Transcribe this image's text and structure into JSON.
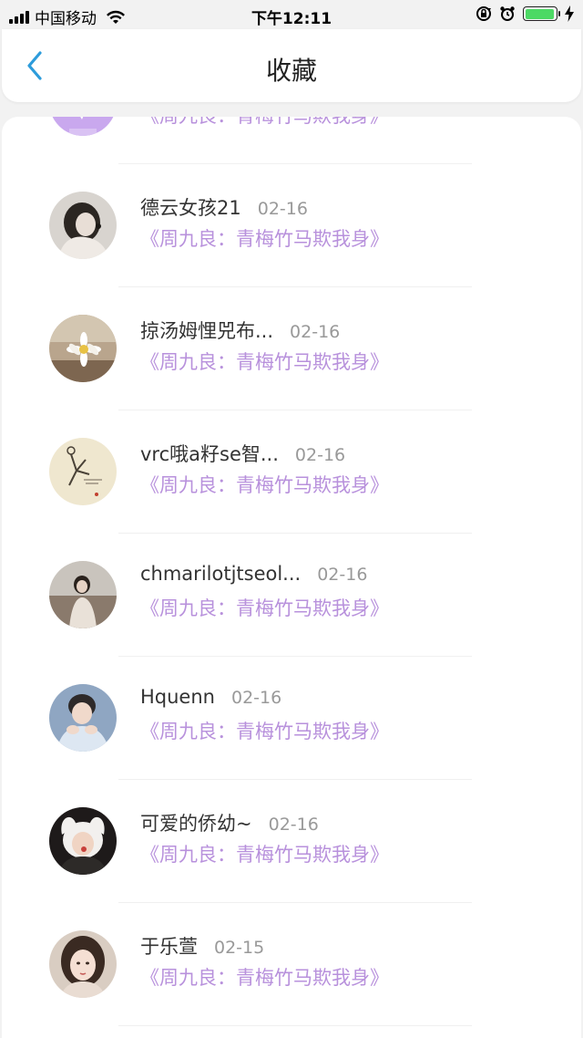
{
  "status_bar": {
    "carrier": "中国移动",
    "time": "下午12:11",
    "battery_level": 0.95,
    "icons": [
      "signal-icon",
      "wifi-icon",
      "rotation-lock-icon",
      "alarm-icon",
      "battery-icon",
      "charging-icon"
    ]
  },
  "nav": {
    "title": "收藏",
    "back_icon": "chevron-left-icon"
  },
  "colors": {
    "accent": "#2d9cdb",
    "book_title": "#b891dc",
    "date": "#999999"
  },
  "list": [
    {
      "username": "",
      "date": "",
      "book_title": "《周九良：青梅竹马欺我身》",
      "avatar": "chat-bubble-avatar"
    },
    {
      "username": "德云女孩21",
      "date": "02-16",
      "book_title": "《周九良：青梅竹马欺我身》",
      "avatar": "user-photo"
    },
    {
      "username": "掠汤姆悝兕布...",
      "date": "02-16",
      "book_title": "《周九良：青梅竹马欺我身》",
      "avatar": "daisy-photo"
    },
    {
      "username": "vrc哦a籽se智...",
      "date": "02-16",
      "book_title": "《周九良：青梅竹马欺我身》",
      "avatar": "sketch-photo"
    },
    {
      "username": "chmarilotjtseol...",
      "date": "02-16",
      "book_title": "《周九良：青梅竹马欺我身》",
      "avatar": "girl-field-photo"
    },
    {
      "username": "Hquenn",
      "date": "02-16",
      "book_title": "《周九良：青梅竹马欺我身》",
      "avatar": "boy-photo"
    },
    {
      "username": "可爱的侨幼~",
      "date": "02-16",
      "book_title": "《周九良：青梅竹马欺我身》",
      "avatar": "bunny-hat-photo"
    },
    {
      "username": "于乐萱",
      "date": "02-15",
      "book_title": "《周九良：青梅竹马欺我身》",
      "avatar": "girl-portrait-photo"
    }
  ]
}
